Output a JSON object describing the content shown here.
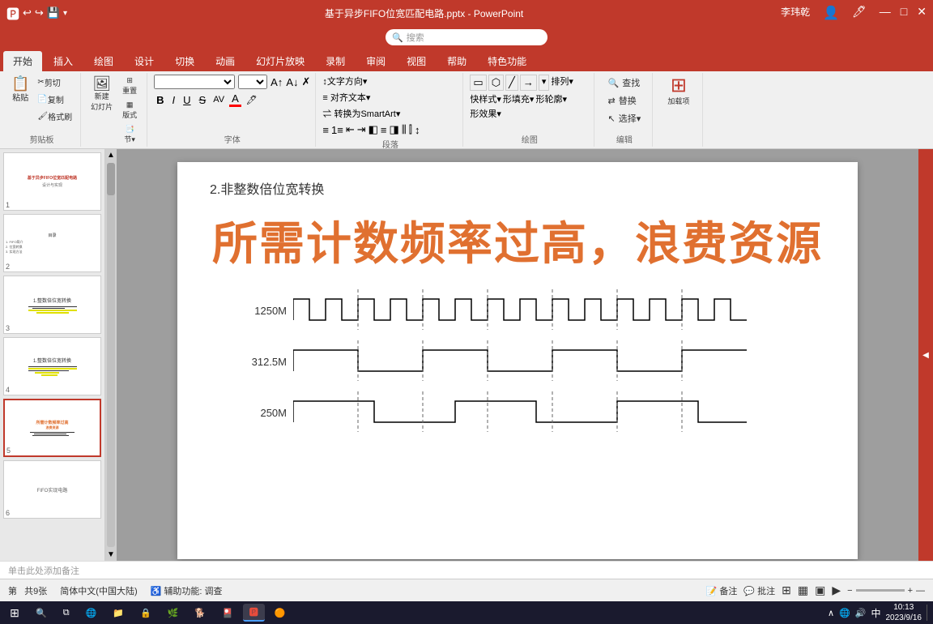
{
  "titlebar": {
    "title": "基于异步FIFO位宽匹配电路.pptx - PowerPoint",
    "minimize": "—",
    "maximize": "□",
    "close": "✕",
    "back": "←",
    "forward": "→",
    "save": "💾",
    "undo_icon": "↩",
    "redo_icon": "↪"
  },
  "user": "李玮乾",
  "search_placeholder": "搜索",
  "ribbon_tabs": [
    "开始",
    "插入",
    "绘图",
    "设计",
    "切换",
    "动画",
    "幻灯片放映",
    "录制",
    "审阅",
    "视图",
    "帮助",
    "特色功能"
  ],
  "ribbon_tab_active": "开始",
  "slide": {
    "subtitle": "2.非整数倍位宽转换",
    "main_text": "所需计数频率过高，浪费资源",
    "waveforms": [
      {
        "label": "1250M",
        "freq": 1250
      },
      {
        "label": "312.5M",
        "freq": 312
      },
      {
        "label": "250M",
        "freq": 250
      }
    ]
  },
  "note_placeholder": "单击此处添加备注",
  "statusbar": {
    "slide_info": "第 共9张",
    "language": "简体中文(中国大陆)",
    "accessibility": "辅助功能: 调查"
  },
  "taskbar": {
    "time": "10:13",
    "date": "2023/9/16",
    "lang": "中",
    "apps": [
      "⊞",
      "🌐",
      "📁",
      "🔒",
      "🌿",
      "🐕",
      "🎴",
      "🔴",
      "🟠"
    ]
  },
  "slides_panel": [
    {
      "num": 1,
      "type": "title"
    },
    {
      "num": 2,
      "type": "content"
    },
    {
      "num": 3,
      "type": "waveform_yellow"
    },
    {
      "num": 4,
      "type": "waveform_yellow2"
    },
    {
      "num": 5,
      "type": "active_orange"
    },
    {
      "num": 6,
      "type": "blank"
    }
  ]
}
